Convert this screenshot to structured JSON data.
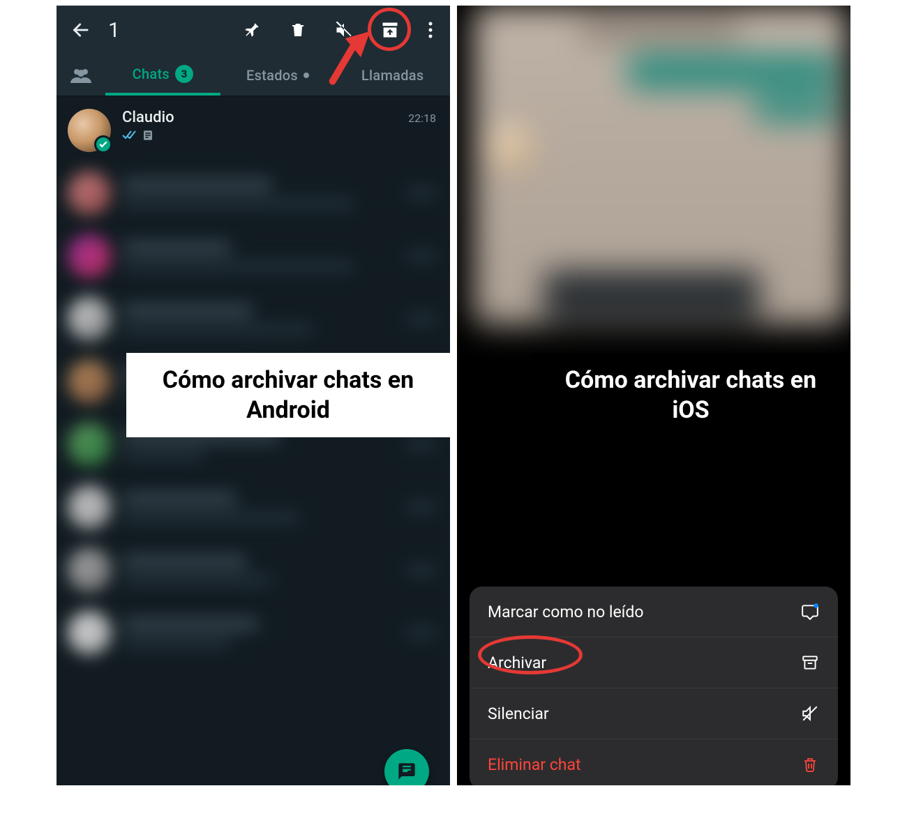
{
  "android": {
    "topbar": {
      "selection_count": "1"
    },
    "tabs": {
      "chats_label": "Chats",
      "chats_badge": "3",
      "status_label": "Estados",
      "calls_label": "Llamadas"
    },
    "chat": {
      "name": "Claudio",
      "time": "22:18"
    },
    "caption": "Cómo archivar chats en Android"
  },
  "ios": {
    "caption": "Cómo archivar chats en iOS",
    "actions": {
      "unread": "Marcar como no leído",
      "archive": "Archivar",
      "mute": "Silenciar",
      "delete": "Eliminar chat"
    }
  }
}
